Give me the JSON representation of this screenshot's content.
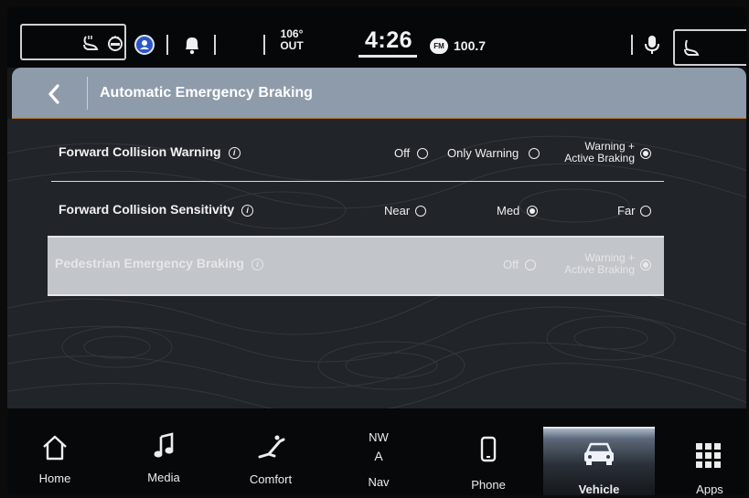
{
  "status_bar": {
    "temperature": "106°",
    "temperature_label": "OUT",
    "time": "4:26",
    "radio_band": "FM",
    "radio_frequency": "100.7"
  },
  "header": {
    "title": "Automatic Emergency Braking"
  },
  "settings": [
    {
      "label": "Forward Collision Warning",
      "options": [
        {
          "label": "Off",
          "selected": false
        },
        {
          "label": "Only Warning",
          "selected": false
        },
        {
          "label_line1": "Warning +",
          "label_line2": "Active Braking",
          "selected": true
        }
      ]
    },
    {
      "label": "Forward Collision Sensitivity",
      "options": [
        {
          "label": "Near",
          "selected": false
        },
        {
          "label": "Med",
          "selected": true
        },
        {
          "label": "Far",
          "selected": false
        }
      ]
    },
    {
      "label": "Pedestrian Emergency Braking",
      "disabled": true,
      "options": [
        {
          "label": "Off",
          "selected": false
        },
        {
          "label_line1": "Warning +",
          "label_line2": "Active Braking",
          "selected": true
        }
      ]
    }
  ],
  "nav": {
    "home": "Home",
    "media": "Media",
    "comfort": "Comfort",
    "nav_heading": "NW",
    "nav_arrow": "A",
    "nav": "Nav",
    "phone": "Phone",
    "vehicle": "Vehicle",
    "apps": "Apps",
    "active": "vehicle"
  },
  "colors": {
    "header_bg": "#8e9bab",
    "header_accent": "#b4782e",
    "content_bg": "#212429",
    "disabled_row_bg": "#c2c5c9"
  }
}
